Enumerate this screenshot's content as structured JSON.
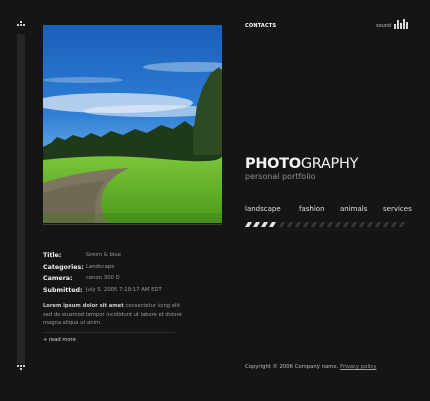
{
  "header": {
    "contacts_label": "CONTACTS",
    "sound_label": "sound"
  },
  "brand": {
    "title_bold": "PHOTO",
    "title_light": "GRAPHY",
    "tagline": "personal portfolio"
  },
  "nav": {
    "items": [
      {
        "label": "landscape"
      },
      {
        "label": "fashion"
      },
      {
        "label": "animals"
      },
      {
        "label": "services"
      }
    ]
  },
  "photo": {
    "alt": "Green & blue"
  },
  "details": {
    "rows": [
      {
        "key": "Title:",
        "value": "Green & blue"
      },
      {
        "key": "Categories:",
        "value": "Landscape"
      },
      {
        "key": "Camera:",
        "value": "canon 300 D"
      },
      {
        "key": "Submitted:",
        "value": "July 5, 2005 7:19:17 AM EDT"
      }
    ]
  },
  "description": {
    "lead": "Lorem ipsum dolor sit amet",
    "body": " consectetur icing elit sed do eiusmod tempor incididunt ut labore et dolore magna aliqua ut enim."
  },
  "read_more": "+ read more",
  "footer": {
    "copyright": "Copyright © 2006 Company name.",
    "privacy_link": "Privacy policy"
  },
  "colors": {
    "background": "#151515",
    "text": "#d8d8d8",
    "muted": "#9a9a9a"
  }
}
